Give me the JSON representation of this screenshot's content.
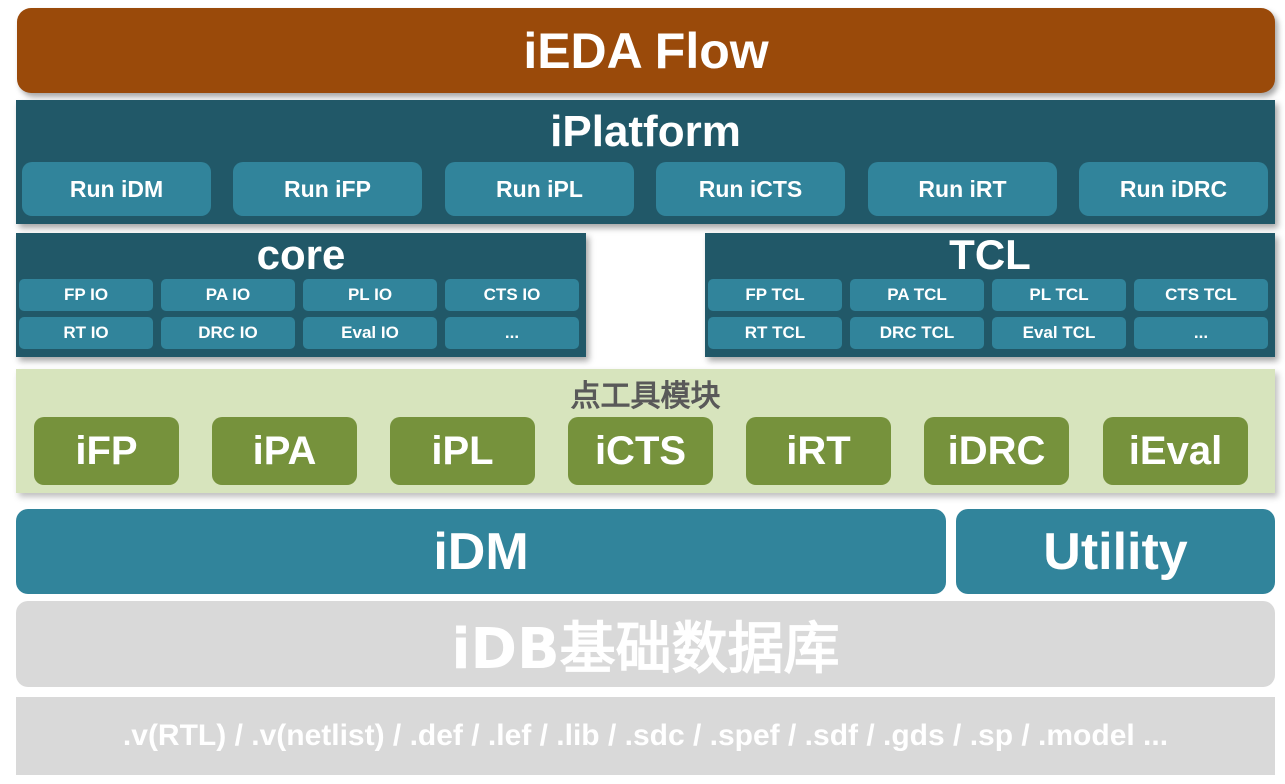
{
  "flow": {
    "title": "iEDA Flow"
  },
  "platform": {
    "title": "iPlatform",
    "buttons": [
      "Run iDM",
      "Run iFP",
      "Run iPL",
      "Run iCTS",
      "Run iRT",
      "Run iDRC"
    ]
  },
  "core": {
    "title": "core",
    "cells": [
      "FP IO",
      "PA IO",
      "PL IO",
      "CTS IO",
      "RT IO",
      "DRC IO",
      "Eval IO",
      "..."
    ]
  },
  "tcl": {
    "title": "TCL",
    "cells": [
      "FP TCL",
      "PA TCL",
      "PL TCL",
      "CTS TCL",
      "RT TCL",
      "DRC TCL",
      "Eval TCL",
      "..."
    ]
  },
  "tools": {
    "title": "点工具模块",
    "items": [
      "iFP",
      "iPA",
      "iPL",
      "iCTS",
      "iRT",
      "iDRC",
      "iEval"
    ]
  },
  "idm": {
    "label": "iDM"
  },
  "utility": {
    "label": "Utility"
  },
  "idb": {
    "label": "iDB基础数据库"
  },
  "files": {
    "label": ".v(RTL) / .v(netlist) / .def / .lef / .lib / .sdc / .spef / .sdf / .gds / .sp / .model ..."
  },
  "colors": {
    "flow": "#9a4a0a",
    "platform_bg": "#215868",
    "teal_box": "#31849b",
    "tools_bg": "#d7e4bd",
    "tool_box": "#76923c",
    "gray_box": "#d9d9d9"
  }
}
